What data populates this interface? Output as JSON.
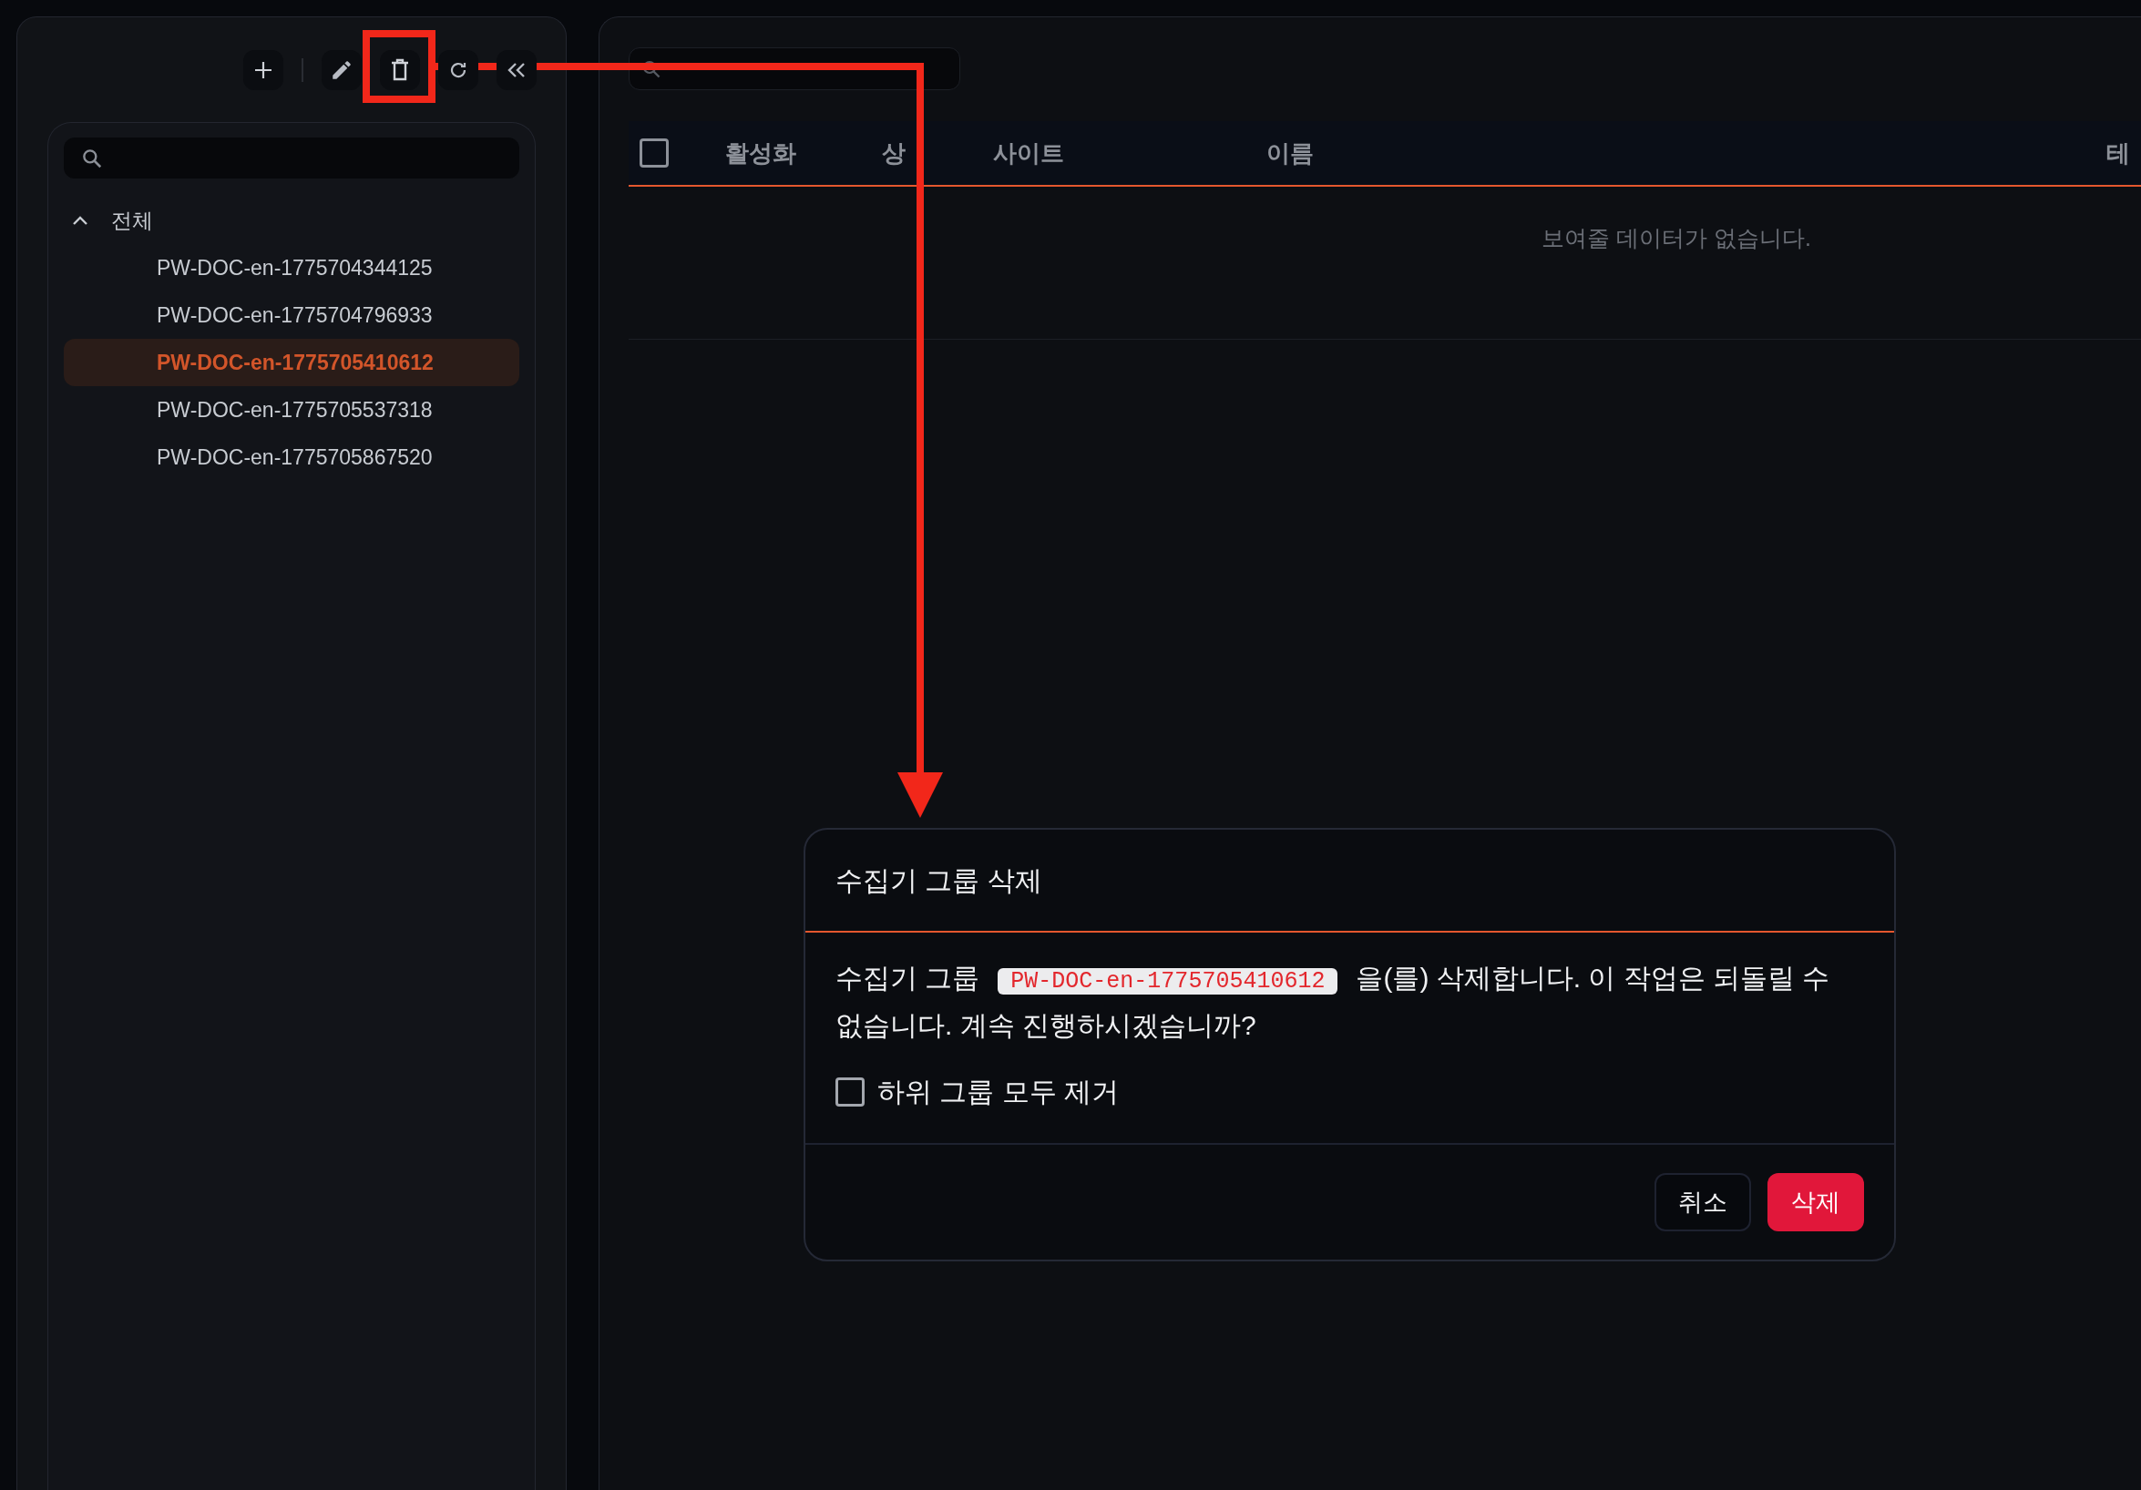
{
  "sidebar": {
    "tree": {
      "label": "전체",
      "expanded": true,
      "children": [
        {
          "label": "PW-DOC-en-1775704344125",
          "selected": false
        },
        {
          "label": "PW-DOC-en-1775704796933",
          "selected": false
        },
        {
          "label": "PW-DOC-en-1775705410612",
          "selected": true
        },
        {
          "label": "PW-DOC-en-1775705537318",
          "selected": false
        },
        {
          "label": "PW-DOC-en-1775705867520",
          "selected": false
        }
      ]
    }
  },
  "main": {
    "table": {
      "select_all_checked": false,
      "columns": [
        "활성화",
        "상",
        "사이트",
        "이름",
        "테"
      ],
      "empty_message": "보여줄 데이터가 없습니다."
    }
  },
  "dialog": {
    "title": "수집기 그룹 삭제",
    "message_before": "수집기 그룹",
    "code": "PW-DOC-en-1775705410612",
    "message_after": "을(를) 삭제합니다. 이 작업은 되돌릴 수 없습니다. 계속 진행하시겠습니까?",
    "checkbox": {
      "label": "하위 그룹 모두 제거",
      "checked": false
    },
    "buttons": [
      {
        "label": "취소",
        "kind": "secondary"
      },
      {
        "label": "삭제",
        "kind": "danger"
      }
    ]
  }
}
